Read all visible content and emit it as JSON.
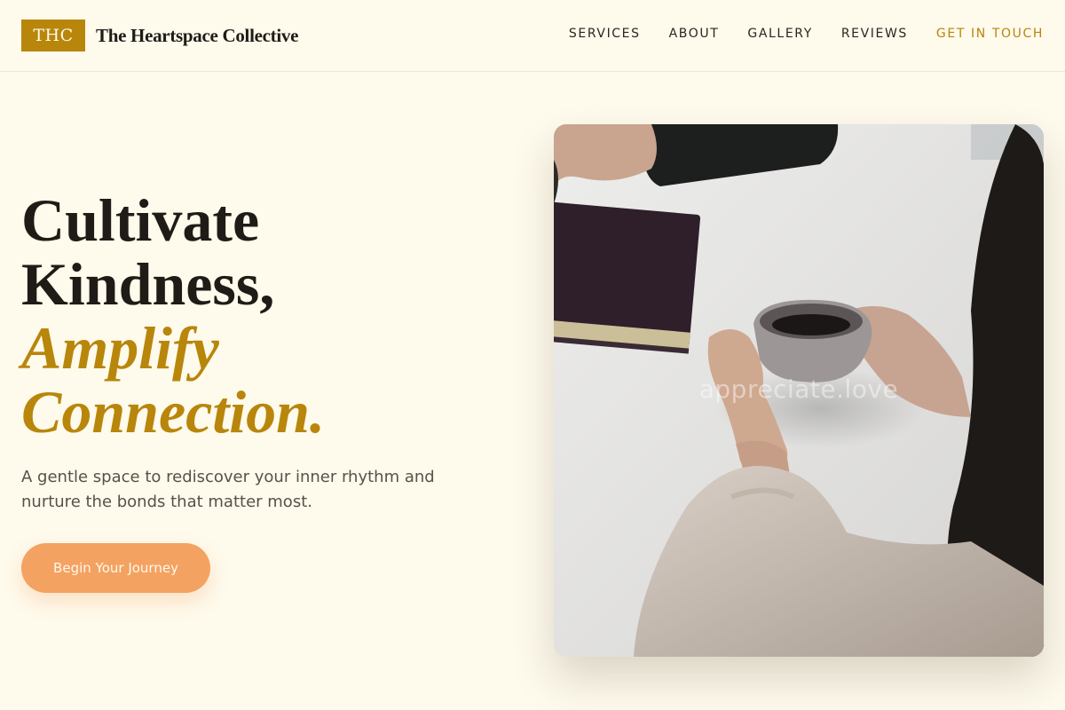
{
  "header": {
    "logo_text": "THC",
    "brand_name": "The Heartspace Collective",
    "nav": [
      {
        "label": "SERVICES"
      },
      {
        "label": "ABOUT"
      },
      {
        "label": "GALLERY"
      },
      {
        "label": "REVIEWS"
      },
      {
        "label": "GET IN TOUCH"
      }
    ]
  },
  "hero": {
    "headline_line1": "Cultivate",
    "headline_line2": "Kindness,",
    "headline_line3": "Amplify",
    "headline_line4": "Connection.",
    "subtitle": "A gentle space to rediscover your inner rhythm and nurture the bonds that matter most.",
    "cta_label": "Begin Your Journey",
    "image_watermark": "appreciate.love"
  },
  "colors": {
    "background": "#fefaec",
    "accent_gold": "#b8860b",
    "cta_orange": "#f4a261",
    "text_dark": "#1f1c17"
  }
}
